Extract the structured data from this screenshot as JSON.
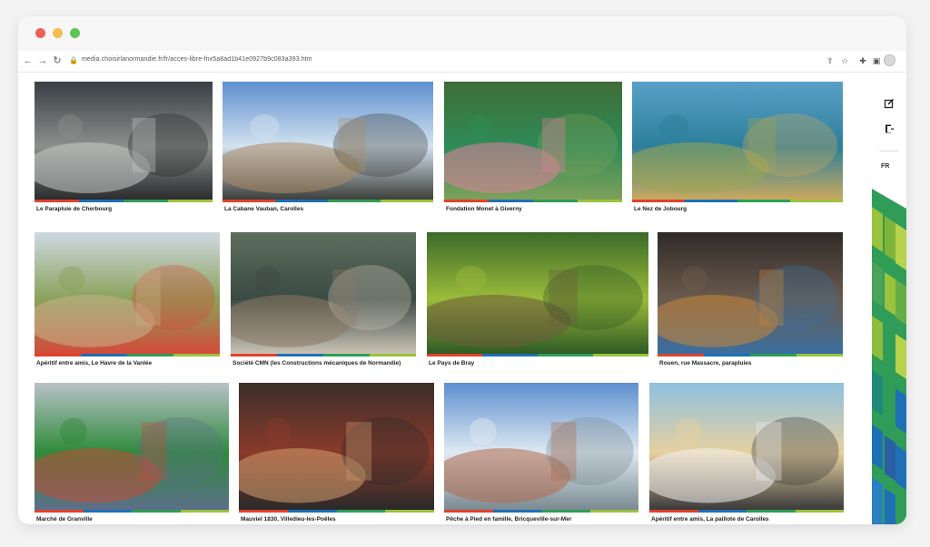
{
  "browser": {
    "url": "media.choisirlanormandie.fr/fr/acces-libre-fnx5a8ad1b41e0927b9c083a393.htm"
  },
  "sidebar": {
    "language": "FR",
    "edit_icon": "edit-icon",
    "exit_icon": "logout-icon"
  },
  "gallery": {
    "rows": [
      [
        {
          "caption": "Le Parapluie de Cherbourg"
        },
        {
          "caption": "La Cabane Vauban, Carolles"
        },
        {
          "caption": "Fondation Monet à Giverny"
        },
        {
          "caption": "Le Nez de Jobourg"
        }
      ],
      [
        {
          "caption": "Apéritif entre amis, Le Havre de la Vanlée"
        },
        {
          "caption": "Société CMN (les Constructions mécaniques de Normandie)"
        },
        {
          "caption": "Le Pays de Bray"
        },
        {
          "caption": "Rouen, rue Massacre, parapluies"
        }
      ],
      [
        {
          "caption": "Marché de Granville"
        },
        {
          "caption": "Mauviel 1830, Villedieu-les-Poêles"
        },
        {
          "caption": "Pêche à Pied en famille, Bricqueville-sur-Mer"
        },
        {
          "caption": "Apéritif entre amis, La paillote de Carolles"
        }
      ]
    ]
  },
  "colors": {
    "strip": [
      "#e2412c",
      "#1f6fb5",
      "#2f9d57",
      "#9bc23c"
    ]
  }
}
